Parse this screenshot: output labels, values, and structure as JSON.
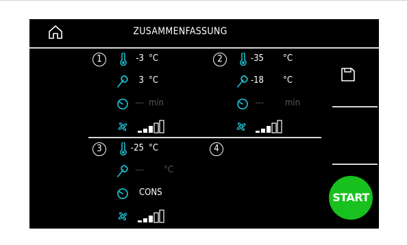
{
  "header": {
    "title": "ZUSAMMENFASSUNG"
  },
  "programs": [
    {
      "number": "1",
      "temp": "-3",
      "temp_unit": "°C",
      "probe": "3",
      "probe_unit": "°C",
      "time": "---",
      "time_unit": "min",
      "fan_level": 3
    },
    {
      "number": "2",
      "temp": "-35",
      "temp_unit": "°C",
      "probe": "-18",
      "probe_unit": "°C",
      "time": "---",
      "time_unit": "min",
      "fan_level": 3
    },
    {
      "number": "3",
      "temp": "-25",
      "temp_unit": "°C",
      "probe": "---",
      "probe_unit": "°C",
      "time": "CONS",
      "fan_level": 3
    },
    {
      "number": "4"
    }
  ],
  "actions": {
    "start_label": "START"
  },
  "colors": {
    "accent": "#1bb7c9",
    "start": "#18c11e",
    "background": "#000000"
  },
  "icons": {
    "home": "home-icon",
    "save": "save-icon",
    "thermometer": "thermometer-icon",
    "probe": "probe-icon",
    "timer": "timer-icon",
    "fan": "fan-icon"
  }
}
